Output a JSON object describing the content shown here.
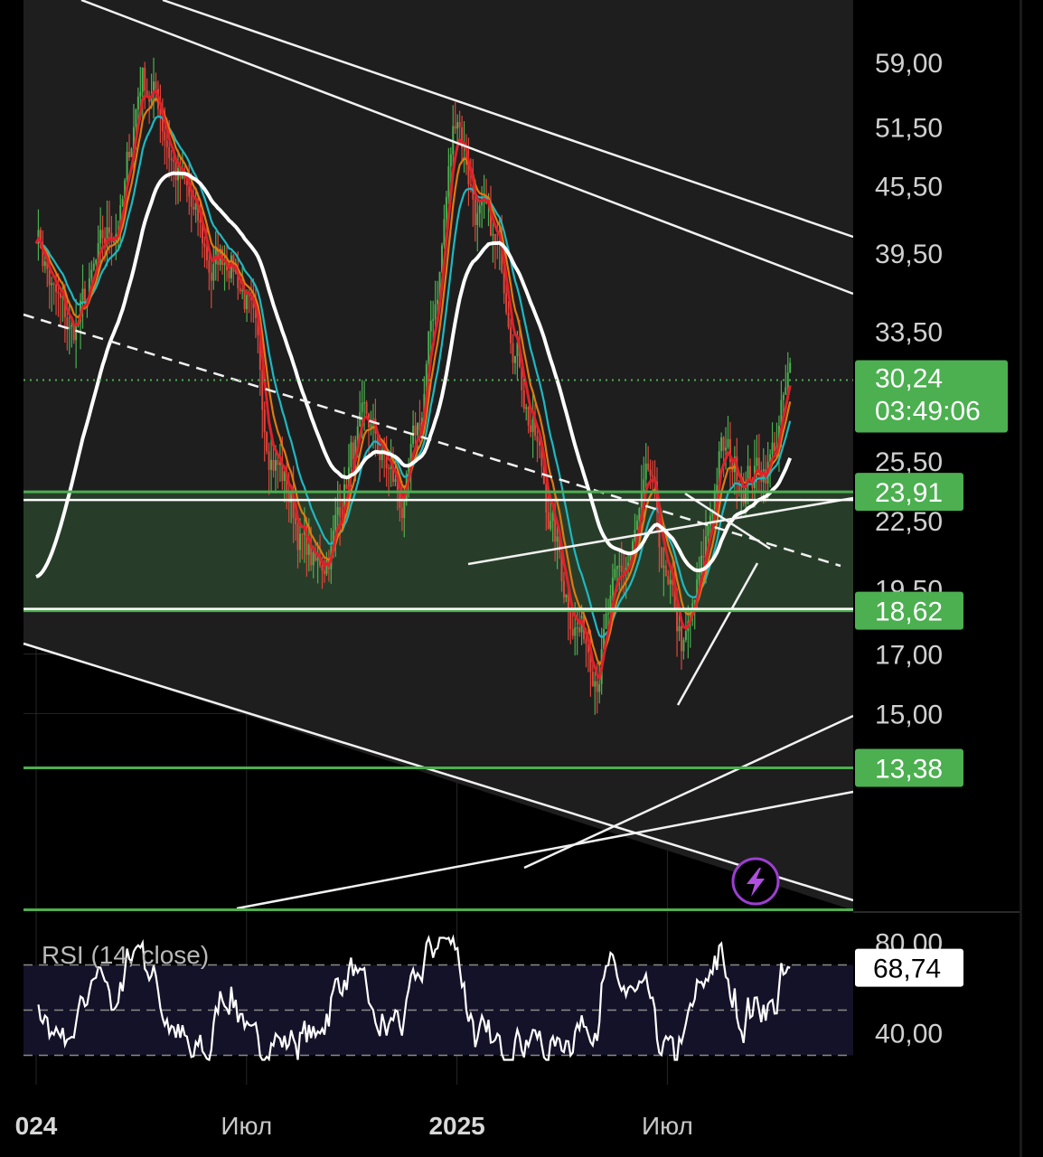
{
  "chart_data": {
    "type": "line",
    "price_axis": {
      "scale": "log",
      "ticks": [
        "59,00",
        "51,50",
        "45,50",
        "39,50",
        "33,50",
        "25,50",
        "22,50",
        "19,50",
        "17,00",
        "15,00"
      ],
      "tick_values": [
        59.0,
        51.5,
        45.5,
        39.5,
        33.5,
        25.5,
        22.5,
        19.5,
        17.0,
        15.0
      ]
    },
    "time_axis": {
      "ticks": [
        "024",
        "Июл",
        "2025",
        "Июл"
      ],
      "bold": [
        true,
        false,
        true,
        false
      ],
      "tick_months": [
        0,
        6,
        12,
        18
      ]
    },
    "current_price": {
      "price": "30,24",
      "countdown": "03:49:06",
      "value": 30.24,
      "color": "#4caf50"
    },
    "levels": [
      {
        "label": "23,91",
        "value": 23.91,
        "color": "#4caf50"
      },
      {
        "label": "18,62",
        "value": 18.62,
        "color": "#4caf50"
      },
      {
        "label": "13,38",
        "value": 13.38,
        "color": "#4caf50"
      }
    ],
    "zone": {
      "from": 18.62,
      "to": 23.91,
      "color": "#4caf50"
    },
    "price_series": {
      "months": [
        0,
        0.5,
        1,
        1.5,
        2,
        2.5,
        3,
        3.5,
        4,
        4.5,
        5,
        5.5,
        6,
        6.5,
        7,
        7.5,
        8,
        8.5,
        9,
        9.5,
        10,
        10.5,
        11,
        11.5,
        12,
        12.5,
        13,
        13.5,
        14,
        14.5,
        15,
        15.5,
        16,
        16.5,
        17,
        17.5,
        18,
        18.5,
        19,
        19.5,
        20,
        20.5,
        21,
        21.5
      ],
      "close": [
        42,
        36,
        33,
        36,
        40,
        44,
        58,
        54,
        47,
        42,
        38,
        40,
        36,
        28,
        25,
        22,
        20,
        22,
        26,
        27,
        25,
        23,
        28,
        38,
        54,
        44,
        40,
        36,
        29,
        24,
        20,
        18,
        17,
        19,
        21,
        24,
        19,
        17,
        20,
        26,
        25,
        25,
        26,
        30
      ]
    },
    "ema_fast": {
      "color": "#e0202a"
    },
    "ema_mid": {
      "color": "#e07a10"
    },
    "ema_slow": {
      "color": "#1fb8c0"
    },
    "ma_long": {
      "color": "#ffffff"
    },
    "rsi": {
      "title": "RSI (14, close)",
      "ticks": [
        "80,00",
        "40,00"
      ],
      "tick_values": [
        80,
        40
      ],
      "bands": [
        70,
        50,
        30
      ],
      "last": "68,74",
      "last_value": 68.74,
      "ylim": [
        25,
        85
      ]
    }
  }
}
